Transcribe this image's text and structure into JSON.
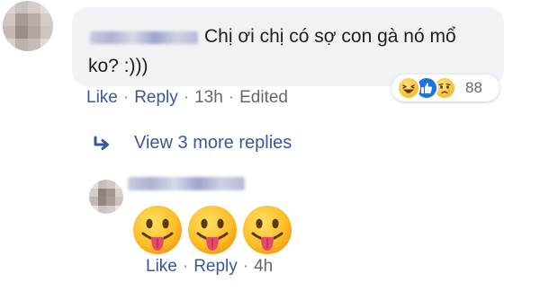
{
  "comment": {
    "author_blurred": true,
    "text_line_1": "Chị ơi chị có sợ con gà nó mổ",
    "text_line_2": "ko? :)))",
    "reactions": {
      "types": [
        "haha",
        "like",
        "sad"
      ],
      "count": "88"
    },
    "actions": {
      "like": "Like",
      "reply": "Reply",
      "time": "13h",
      "edited": "Edited"
    }
  },
  "view_replies": {
    "label": "View 3 more replies"
  },
  "reply": {
    "author_blurred": true,
    "emojis": [
      "tongue-out-face",
      "tongue-out-face",
      "tongue-out-face"
    ],
    "actions": {
      "like": "Like",
      "reply": "Reply",
      "time": "4h"
    }
  },
  "colors": {
    "link": "#385898",
    "meta": "#65676b",
    "bubble": "#f0f2f5",
    "like_blue": "#1b74e4"
  },
  "icons": {
    "reply_arrow": "reply-arrow-icon",
    "haha": "haha-reaction-icon",
    "like": "like-reaction-icon",
    "sad": "sad-reaction-icon"
  }
}
